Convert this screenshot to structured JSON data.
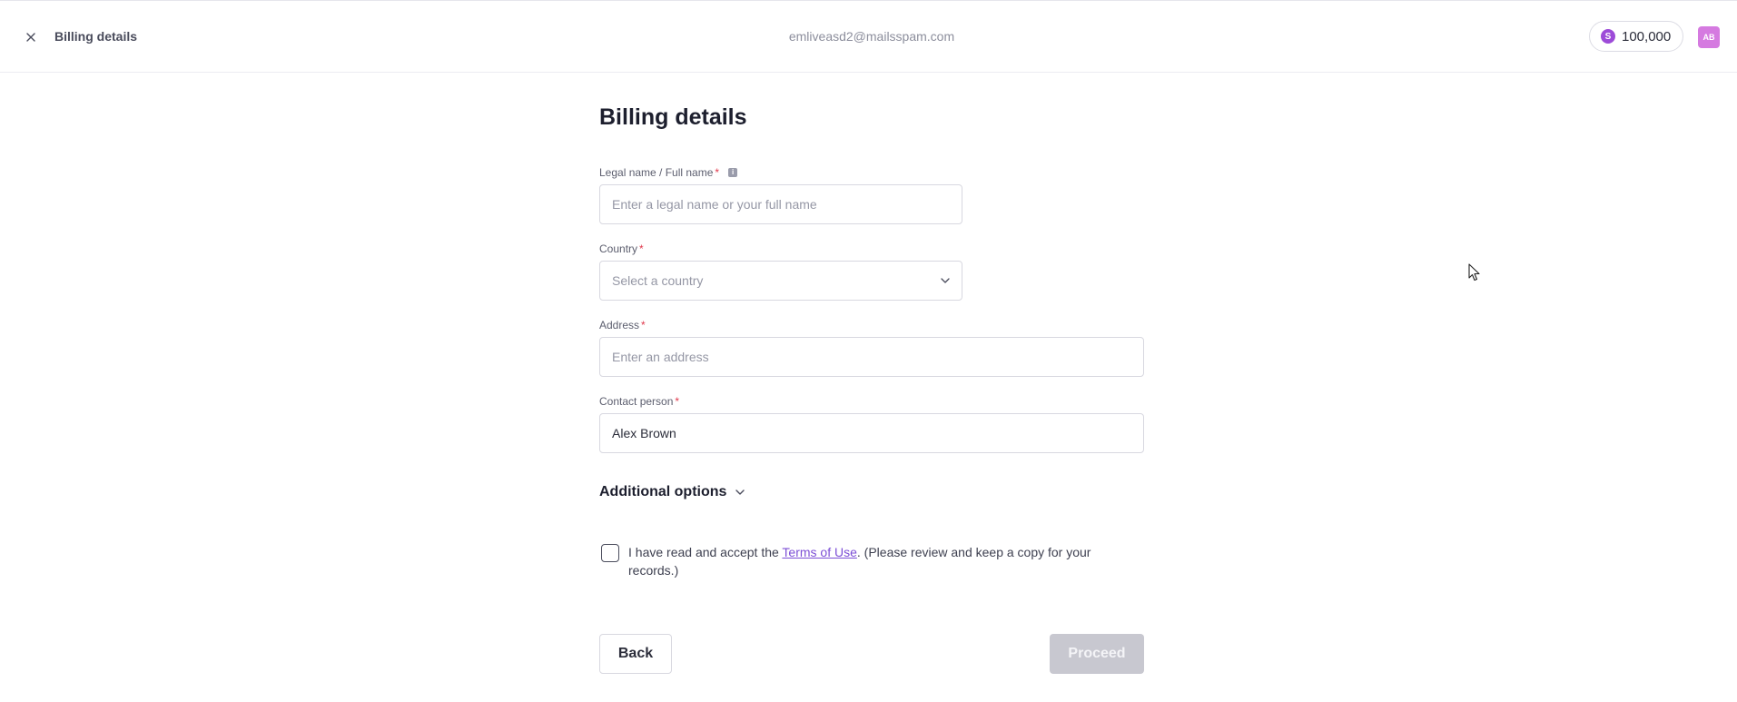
{
  "header": {
    "title": "Billing details",
    "email": "emliveasd2@mailsspam.com",
    "credits": "100,000",
    "coin_symbol": "S",
    "avatar_initials": "AB"
  },
  "form": {
    "title": "Billing details",
    "legal_name": {
      "label": "Legal name / Full name",
      "required_mark": "*",
      "info_icon": "i",
      "placeholder": "Enter a legal name or your full name",
      "value": ""
    },
    "country": {
      "label": "Country",
      "required_mark": "*",
      "placeholder": "Select a country"
    },
    "address": {
      "label": "Address",
      "required_mark": "*",
      "placeholder": "Enter an address",
      "value": ""
    },
    "contact_person": {
      "label": "Contact person",
      "required_mark": "*",
      "value": "Alex Brown"
    },
    "additional_options": "Additional options",
    "terms": {
      "prefix": "I have read and accept the ",
      "link": "Terms of Use",
      "suffix": ". (Please review and keep a copy for your records.)",
      "checked": false
    },
    "back_label": "Back",
    "proceed_label": "Proceed"
  },
  "colors": {
    "accent": "#7d4fd6",
    "required": "#e0394c",
    "coin": "#9d4bd8",
    "avatar": "#d57ae0",
    "disabled_button": "#c8c8d0"
  },
  "icons": [
    "close-icon",
    "coin-icon",
    "info-icon",
    "chevron-down-icon",
    "mouse-cursor-icon"
  ]
}
